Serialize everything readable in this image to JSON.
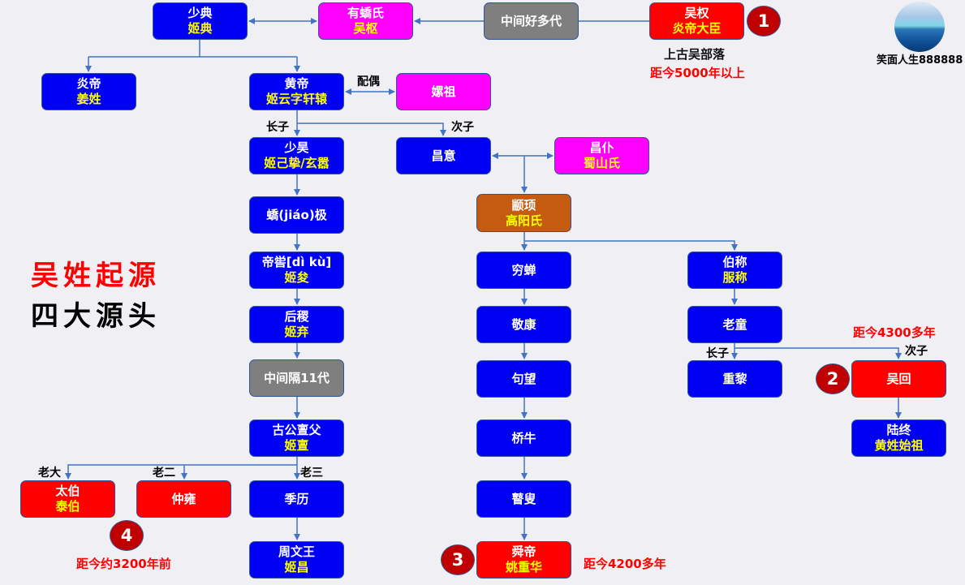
{
  "title": {
    "line1": "吴姓起源",
    "line2": "四大源头"
  },
  "author": {
    "name": "笑面人生888888",
    "avatar_icon": "ocean-avatar"
  },
  "colors": {
    "blue": "#0000f5",
    "magenta": "#ff00ff",
    "gray": "#7f7f7f",
    "red": "#ff0000",
    "brown": "#c55a11",
    "line": "#4472c4",
    "sub_text": "#ffff00",
    "badge": "#c00000"
  },
  "nodes": {
    "shaodian": {
      "l1": "少典",
      "l2": "姬典"
    },
    "youjiaoshi": {
      "l1": "有蟜氏",
      "l2": "吴枢"
    },
    "zhongjian_duodai": {
      "l1": "中间好多代",
      "l2": ""
    },
    "wuquan": {
      "l1": "吴权",
      "l2": "炎帝大臣"
    },
    "yandi": {
      "l1": "炎帝",
      "l2": "姜姓"
    },
    "huangdi": {
      "l1": "黄帝",
      "l2": "姬云字轩辕"
    },
    "leizu": {
      "l1": "嫘祖",
      "l2": ""
    },
    "shaohao": {
      "l1": "少昊",
      "l2": "姬己挚/玄嚣"
    },
    "changyi": {
      "l1": "昌意",
      "l2": ""
    },
    "changpu": {
      "l1": "昌仆",
      "l2": "蜀山氏"
    },
    "zhuanxu": {
      "l1": "颛顼",
      "l2": "高阳氏"
    },
    "jiaoji": {
      "l1": "蟜(jiáo)极",
      "l2": ""
    },
    "diku": {
      "l1": "帝喾[dì kù]",
      "l2": "姬夋"
    },
    "houji": {
      "l1": "后稷",
      "l2": "姬弃"
    },
    "zhongjian_11": {
      "l1": "中间隔11代",
      "l2": ""
    },
    "gugong": {
      "l1": "古公亶父",
      "l2": "姬亶"
    },
    "taibo": {
      "l1": "太伯",
      "l2": "泰伯"
    },
    "zhongyong": {
      "l1": "仲雍",
      "l2": ""
    },
    "jili": {
      "l1": "季历",
      "l2": ""
    },
    "zhouwenwang": {
      "l1": "周文王",
      "l2": "姬昌"
    },
    "qiongchan": {
      "l1": "穷蝉",
      "l2": ""
    },
    "jingkang": {
      "l1": "敬康",
      "l2": ""
    },
    "juwang": {
      "l1": "句望",
      "l2": ""
    },
    "qiaoniu": {
      "l1": "桥牛",
      "l2": ""
    },
    "gusou": {
      "l1": "瞽叟",
      "l2": ""
    },
    "shundi": {
      "l1": "舜帝",
      "l2": "姚重华"
    },
    "bocheng": {
      "l1": "伯称",
      "l2": "服称"
    },
    "laotong": {
      "l1": "老童",
      "l2": ""
    },
    "zhongli": {
      "l1": "重黎",
      "l2": ""
    },
    "wuhui": {
      "l1": "吴回",
      "l2": ""
    },
    "luzhong": {
      "l1": "陆终",
      "l2": "黄姓始祖"
    }
  },
  "labels": {
    "spouse": "配偶",
    "eldest_son_1": "长子",
    "second_son_1": "次子",
    "eldest_son_2": "长子",
    "second_son_2": "次子",
    "laoda": "老大",
    "laoer": "老二",
    "laosan": "老三"
  },
  "notes": {
    "tribe": "上古吴部落",
    "years_5000": "距今5000年以上",
    "years_4300": "距今4300多年",
    "years_4200": "距今4200多年",
    "years_3200": "距今约3200年前"
  },
  "badges": [
    "1",
    "2",
    "3",
    "4"
  ]
}
